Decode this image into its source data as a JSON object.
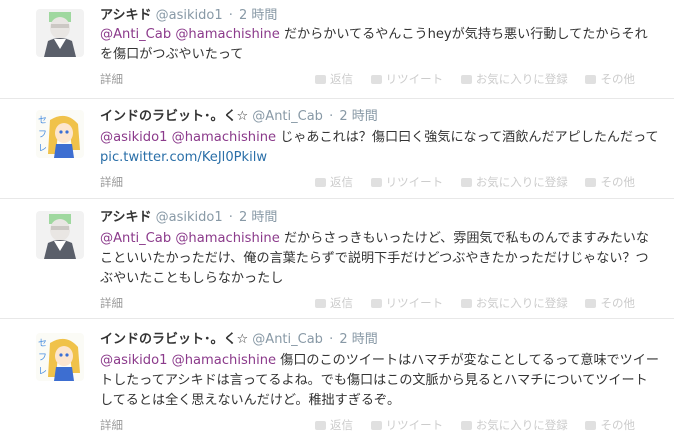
{
  "tweets": [
    {
      "name": "アシキド",
      "screen": "@asikido1",
      "dot": "·",
      "time": "2 時間",
      "m1": "@Anti_Cab",
      "m2": "@hamachishine",
      "body": " だからかいてるやんこうheyが気持ち悪い行動してたからそれを傷口がつぶやいたって",
      "link": "",
      "detail": "詳細",
      "actions": [
        "返信",
        "リツイート",
        "お気に入りに登録",
        "その他"
      ]
    },
    {
      "name": "インドのラビット･。く☆",
      "screen": "@Anti_Cab",
      "dot": "·",
      "time": "2 時間",
      "m1": "@asikido1",
      "m2": "@hamachishine",
      "body": " じゃあこれは？傷口曰く強気になって酒飲んだアピしたんだって ",
      "link": "pic.twitter.com/KeJl0Pkilw",
      "detail": "詳細",
      "actions": [
        "返信",
        "リツイート",
        "お気に入りに登録",
        "その他"
      ]
    },
    {
      "name": "アシキド",
      "screen": "@asikido1",
      "dot": "·",
      "time": "2 時間",
      "m1": "@Anti_Cab",
      "m2": "@hamachishine",
      "body": " だからさっきもいったけど、雰囲気で私ものんでますみたいなこといいたかっただけ、俺の言葉たらずで説明下手だけどつぶやきたかっただけじゃない？つぶやいたこともしらなかったし",
      "link": "",
      "detail": "詳細",
      "actions": [
        "返信",
        "リツイート",
        "お気に入りに登録",
        "その他"
      ]
    },
    {
      "name": "インドのラビット･。く☆",
      "screen": "@Anti_Cab",
      "dot": "·",
      "time": "2 時間",
      "m1": "@asikido1",
      "m2": "@hamachishine",
      "body": " 傷口のこのツイートはハマチが変なことしてるって意味でツイートしたってアシキドは言ってるよね。でも傷口はこの文脈から見るとハマチについてツイートしてるとは全く思えないんだけど。稚拙すぎるぞ。",
      "link": "",
      "detail": "詳細",
      "actions": [
        "返信",
        "リツイート",
        "お気に入りに登録",
        "その他"
      ]
    }
  ],
  "avatar_text": {
    "se": "セ",
    "fu": "フ",
    "re": "レ"
  }
}
